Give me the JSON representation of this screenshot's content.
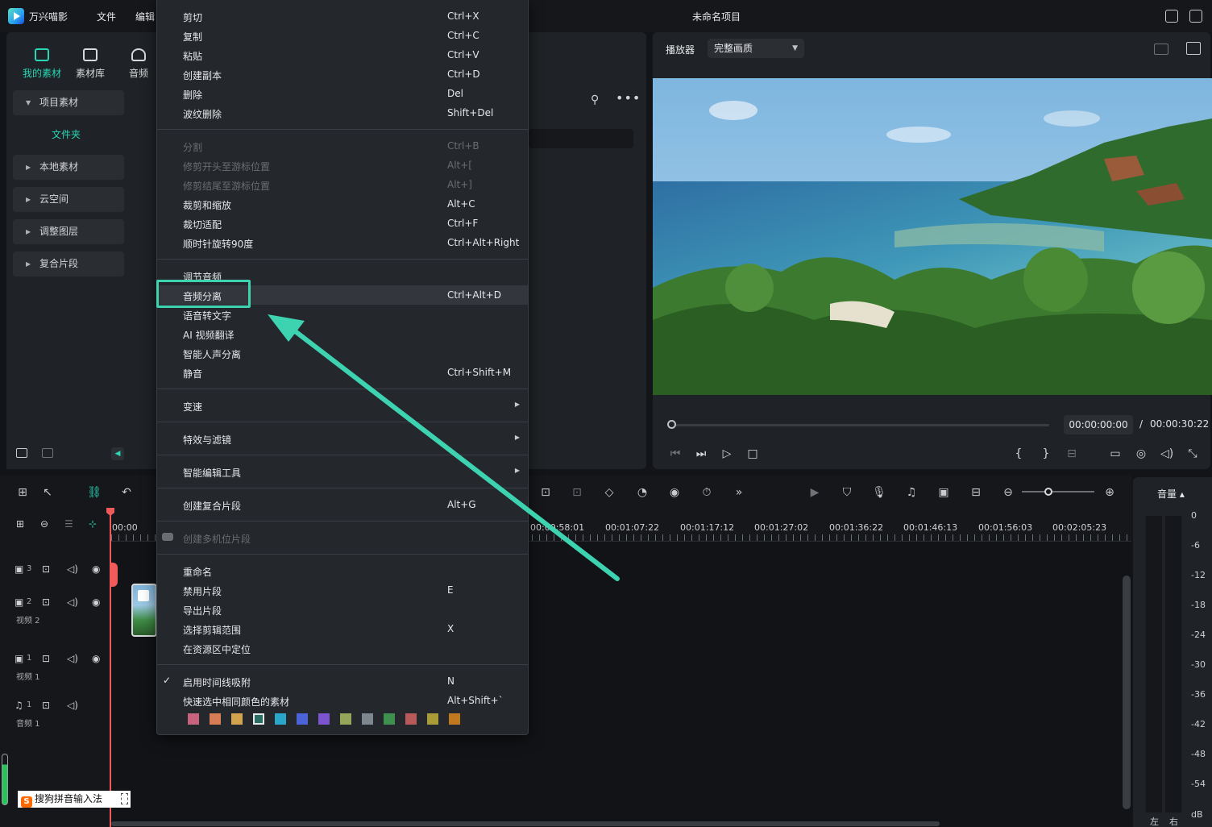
{
  "app": {
    "name": "万兴喵影",
    "project_title": "未命名项目",
    "menus": [
      "文件",
      "编辑"
    ]
  },
  "media_panel": {
    "tabs": [
      {
        "label": "我的素材",
        "icon": "media-icon",
        "active": true
      },
      {
        "label": "素材库",
        "icon": "cloud-library-icon",
        "active": false
      },
      {
        "label": "音频",
        "icon": "music-note-icon",
        "active": false
      }
    ],
    "sidebar": {
      "items": [
        {
          "label": "项目素材",
          "expanded": true
        },
        {
          "label": "本地素材",
          "expanded": false
        },
        {
          "label": "云空间",
          "expanded": false
        },
        {
          "label": "调整图层",
          "expanded": false
        },
        {
          "label": "复合片段",
          "expanded": false
        }
      ],
      "folder_label": "文件夹"
    }
  },
  "player": {
    "label": "播放器",
    "quality": "完整画质",
    "current_time": "00:00:00:00",
    "separator": "/",
    "total_time": "00:00:30:22",
    "progress": 0.0
  },
  "timeline": {
    "ruler_labels": [
      "00:00",
      "00:00:58:01",
      "00:01:07:22",
      "00:01:17:12",
      "00:01:27:02",
      "00:01:36:22",
      "00:01:46:13",
      "00:01:56:03",
      "00:02:05:23"
    ],
    "tracks": [
      {
        "number": "3",
        "name": ""
      },
      {
        "number": "2",
        "name": "视频 2"
      },
      {
        "number": "1",
        "name": "视频 1"
      },
      {
        "number": "1",
        "name": "音频 1"
      }
    ]
  },
  "volume_meter": {
    "title": "音量",
    "db_labels": [
      "0",
      "-6",
      "-12",
      "-18",
      "-24",
      "-30",
      "-36",
      "-42",
      "-48",
      "-54",
      "dB"
    ],
    "left_label": "左",
    "right_label": "右"
  },
  "ime": {
    "label": "搜狗拼音输入法",
    "logo": "S"
  },
  "context_menu": {
    "groups": [
      [
        {
          "label": "剪切",
          "shortcut": "Ctrl+X"
        },
        {
          "label": "复制",
          "shortcut": "Ctrl+C"
        },
        {
          "label": "粘贴",
          "shortcut": "Ctrl+V"
        },
        {
          "label": "创建副本",
          "shortcut": "Ctrl+D"
        },
        {
          "label": "删除",
          "shortcut": "Del"
        },
        {
          "label": "波纹删除",
          "shortcut": "Shift+Del"
        }
      ],
      [
        {
          "label": "分割",
          "shortcut": "Ctrl+B",
          "disabled": true
        },
        {
          "label": "修剪开头至游标位置",
          "shortcut": "Alt+[",
          "disabled": true
        },
        {
          "label": "修剪结尾至游标位置",
          "shortcut": "Alt+]",
          "disabled": true
        },
        {
          "label": "裁剪和缩放",
          "shortcut": "Alt+C"
        },
        {
          "label": "裁切适配",
          "shortcut": "Ctrl+F"
        },
        {
          "label": "顺时针旋转90度",
          "shortcut": "Ctrl+Alt+Right"
        }
      ],
      [
        {
          "label": "调节音频",
          "shortcut": ""
        },
        {
          "label": "音频分离",
          "shortcut": "Ctrl+Alt+D",
          "highlighted": true
        },
        {
          "label": "语音转文字",
          "shortcut": ""
        },
        {
          "label": "AI 视频翻译",
          "shortcut": ""
        },
        {
          "label": "智能人声分离",
          "shortcut": ""
        },
        {
          "label": "静音",
          "shortcut": "Ctrl+Shift+M"
        }
      ],
      [
        {
          "label": "变速",
          "submenu": true
        }
      ],
      [
        {
          "label": "特效与滤镜",
          "submenu": true
        }
      ],
      [
        {
          "label": "智能编辑工具",
          "submenu": true
        }
      ],
      [
        {
          "label": "创建复合片段",
          "shortcut": "Alt+G"
        }
      ],
      [
        {
          "label": "创建多机位片段",
          "shortcut": "",
          "disabled": true
        }
      ],
      [
        {
          "label": "重命名",
          "shortcut": ""
        },
        {
          "label": "禁用片段",
          "shortcut": "E"
        },
        {
          "label": "导出片段",
          "shortcut": ""
        },
        {
          "label": "选择剪辑范围",
          "shortcut": "X"
        },
        {
          "label": "在资源区中定位",
          "shortcut": ""
        }
      ],
      [
        {
          "label": "启用时间线吸附",
          "shortcut": "N",
          "checked": true
        },
        {
          "label": "快速选中相同颜色的素材",
          "shortcut": "Alt+Shift+`"
        }
      ]
    ],
    "color_swatches": [
      "#c7637f",
      "#d77d55",
      "#d2a24c",
      "#2a6f64",
      "#2aa6c8",
      "#4a63d6",
      "#7b55cf",
      "#95a55a",
      "#7c8790",
      "#3f8f4f",
      "#b95a5a",
      "#a79c38",
      "#c0791f"
    ],
    "selected_swatch": 3
  },
  "annotation": {
    "color": "#3ed3b0"
  }
}
